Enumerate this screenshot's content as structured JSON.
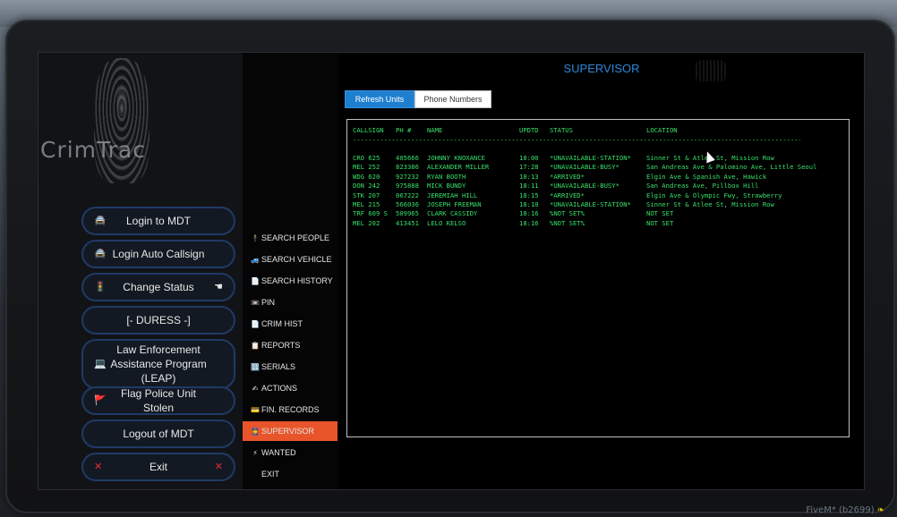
{
  "left_panel": {
    "logo_text": "CrimTrac",
    "buttons": [
      {
        "label": "Login to MDT",
        "icon": "car-icon",
        "icon_glyph": "🚔"
      },
      {
        "label": "Login Auto Callsign",
        "icon": "car-icon",
        "icon_glyph": "🚔"
      },
      {
        "label": "Change Status",
        "icon": "traffic-light-icon",
        "icon_glyph": "🚦",
        "right_icon": "pointing-hand-icon",
        "right_glyph": "☚"
      },
      {
        "label": "[- DURESS -]"
      },
      {
        "label": "Law Enforcement Assistance Program (LEAP)",
        "icon": "laptop-icon",
        "icon_glyph": "💻"
      },
      {
        "label": "Flag Police Unit Stolen",
        "icon": "flag-icon",
        "icon_glyph": "🚩"
      },
      {
        "label": "Logout of MDT"
      },
      {
        "label": "Exit",
        "icon": "close-icon",
        "icon_glyph": "✕",
        "right_icon": "close-icon",
        "right_glyph": "✕"
      }
    ]
  },
  "nav": {
    "items": [
      {
        "label": "SEARCH PEOPLE",
        "icon_glyph": "🕴"
      },
      {
        "label": "SEARCH VEHICLE",
        "icon_glyph": "🚙"
      },
      {
        "label": "SEARCH HISTORY",
        "icon_glyph": "📄"
      },
      {
        "label": "PIN",
        "icon_glyph": "📼"
      },
      {
        "label": "CRIM HIST",
        "icon_glyph": "📄"
      },
      {
        "label": "REPORTS",
        "icon_glyph": "📋"
      },
      {
        "label": "SERIALS",
        "icon_glyph": "🔢"
      },
      {
        "label": "ACTIONS",
        "icon_glyph": "✍"
      },
      {
        "label": "FIN. RECORDS",
        "icon_glyph": "💳"
      },
      {
        "label": "SUPERVISOR",
        "icon_glyph": "👮",
        "active": true
      },
      {
        "label": "WANTED",
        "icon_glyph": "⚡"
      },
      {
        "label": "EXIT",
        "icon_glyph": ""
      }
    ]
  },
  "main": {
    "title": "SUPERVISOR",
    "tabs": [
      "Refresh Units",
      "Phone Numbers"
    ],
    "table": {
      "headers": [
        "CALLSIGN",
        "PH #",
        "NAME",
        "UPDTD",
        "STATUS",
        "LOCATION"
      ],
      "separator": "-----------------------------------------------------------------------------------------------------------------------------",
      "rows": [
        [
          "CRO 625",
          "405666",
          "JOHNNY KNOXANCE",
          "18:00",
          "*UNAVAILABLE-STATION*",
          "Sinner St & Atlee St, Mission Row"
        ],
        [
          "MEL 252",
          "823386",
          "ALEXANDER MILLER",
          "17:28",
          "*UNAVAILABLE-BUSY*",
          "San Andreas Ave & Palomino Ave, Little Seoul"
        ],
        [
          "WDG 620",
          "927232",
          "RYAN BOOTH",
          "18:13",
          "*ARRIVED*",
          "Elgin Ave & Spanish Ave, Hawick"
        ],
        [
          "DON 242",
          "975888",
          "MICK BUNDY",
          "18:11",
          "*UNAVAILABLE-BUSY*",
          "San Andreas Ave, Pillbox Hill"
        ],
        [
          "STK 207",
          "067222",
          "JEREMIAH HILL",
          "18:15",
          "*ARRIVED*",
          "Elgin Ave & Olympic Fwy, Strawberry"
        ],
        [
          "MEL 215",
          "566036",
          "JOSEPH FREEMAN",
          "18:10",
          "*UNAVAILABLE-STATION*",
          "Sinner St & Atlee St, Mission Row"
        ],
        [
          "TRF 609 S",
          "509965",
          "CLARK CASSIDY",
          "18:16",
          "%NOT SET%",
          "NOT SET"
        ],
        [
          "MEL 202",
          "413451",
          "LELO KELSO",
          "18:16",
          "%NOT SET%",
          "NOT SET"
        ]
      ]
    }
  },
  "footer": {
    "fivem_text": "FiveM* (b2699)",
    "leaf_glyph": "❧"
  },
  "colors": {
    "accent_blue": "#1e7fd1",
    "active_nav": "#e8552b",
    "terminal_green": "#38e06a"
  }
}
